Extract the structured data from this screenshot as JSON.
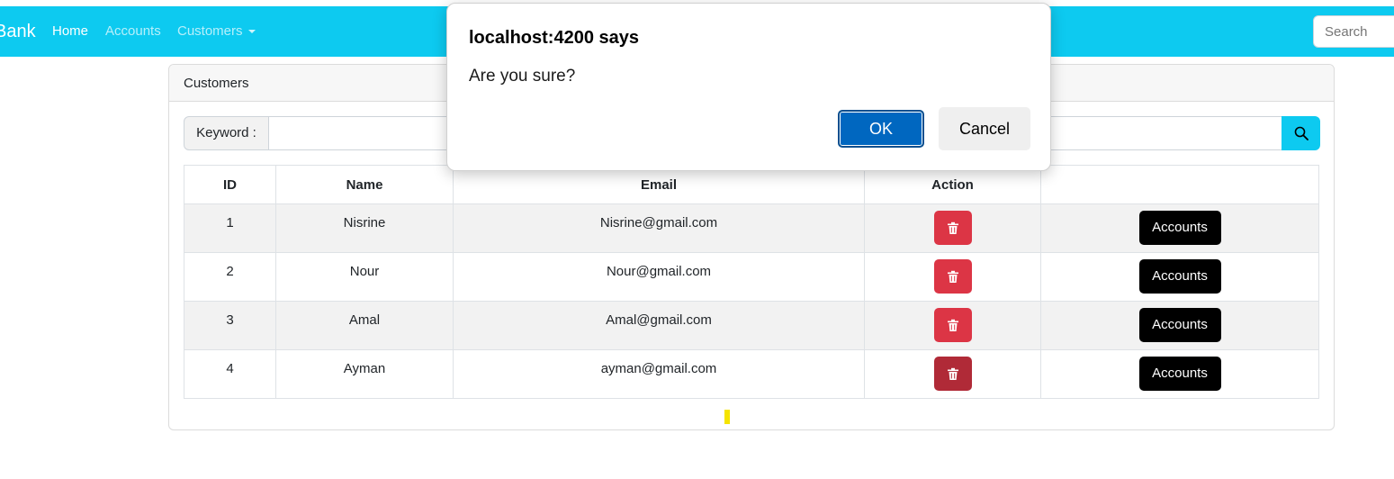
{
  "navbar": {
    "brand": "Bank",
    "links": [
      {
        "label": "Home",
        "active": true
      },
      {
        "label": "Accounts",
        "active": false
      },
      {
        "label": "Customers",
        "active": false
      }
    ],
    "search_placeholder": "Search",
    "background_color": "#0dcaf0"
  },
  "card": {
    "header": "Customers",
    "keyword_label": "Keyword :",
    "keyword_value": "",
    "search_icon": "search-icon"
  },
  "table": {
    "columns": [
      "ID",
      "Name",
      "Email",
      "Action",
      ""
    ],
    "rows": [
      {
        "id": "1",
        "name": "Nisrine",
        "email": "Nisrine@gmail.com",
        "accounts_label": "Accounts"
      },
      {
        "id": "2",
        "name": "Nour",
        "email": "Nour@gmail.com",
        "accounts_label": "Accounts"
      },
      {
        "id": "3",
        "name": "Amal",
        "email": "Amal@gmail.com",
        "accounts_label": "Accounts"
      },
      {
        "id": "4",
        "name": "Ayman",
        "email": "ayman@gmail.com",
        "accounts_label": "Accounts"
      }
    ],
    "delete_icon": "trash-icon",
    "delete_color": "#dc3545"
  },
  "dialog": {
    "title": "localhost:4200 says",
    "message": "Are you sure?",
    "ok_label": "OK",
    "cancel_label": "Cancel",
    "ok_color": "#0067c0"
  }
}
